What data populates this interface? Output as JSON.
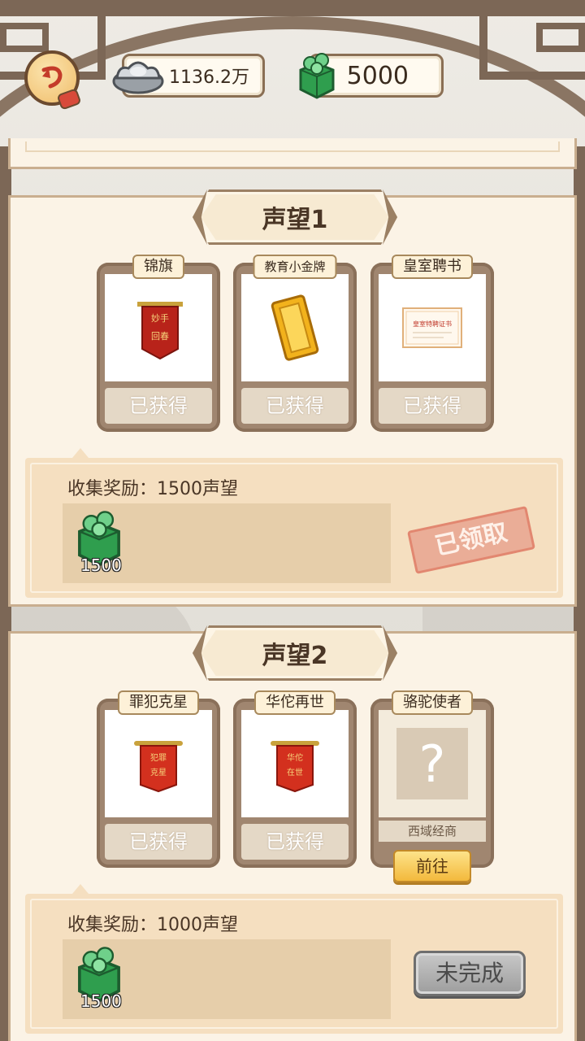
{
  "header": {
    "silver_amount": "1136.2万",
    "jade_amount": "5000"
  },
  "groups": [
    {
      "title": "声望1",
      "items": [
        {
          "name": "锦旗",
          "status": "已获得",
          "icon": "red-banner-icon",
          "banner_text": "妙手回春"
        },
        {
          "name": "教育小金牌",
          "status": "已获得",
          "icon": "gold-plaque-icon"
        },
        {
          "name": "皇室聘书",
          "status": "已获得",
          "icon": "certificate-icon",
          "certificate_text": "皇室特聘证书"
        }
      ],
      "reward_label": "收集奖励：1500声望",
      "reward_item": {
        "icon": "jade-icon",
        "quantity": "1500"
      },
      "reward_state": "已领取"
    },
    {
      "title": "声望2",
      "items": [
        {
          "name": "罪犯克星",
          "status": "已获得",
          "icon": "red-banner-icon",
          "banner_text": "犯罪克星"
        },
        {
          "name": "华佗再世",
          "status": "已获得",
          "icon": "red-banner-icon",
          "banner_text": "华佗在世"
        },
        {
          "name": "骆驼使者",
          "status": "",
          "icon": "question-icon",
          "unknown_mark": "?",
          "hint": "西域经商",
          "action_label": "前往"
        }
      ],
      "reward_label": "收集奖励：1000声望",
      "reward_item": {
        "icon": "jade-icon",
        "quantity": "1500"
      },
      "reward_state": "未完成"
    }
  ],
  "colors": {
    "panel_bg": "#fbf3e6",
    "reward_bg": "#f5dfc0",
    "claimed_stamp": "#e07e68",
    "goto_button": "#f3b93c",
    "incomplete_button": "#9d9d9d",
    "jade_green": "#3bb35a",
    "banner_red": "#c8281e"
  }
}
